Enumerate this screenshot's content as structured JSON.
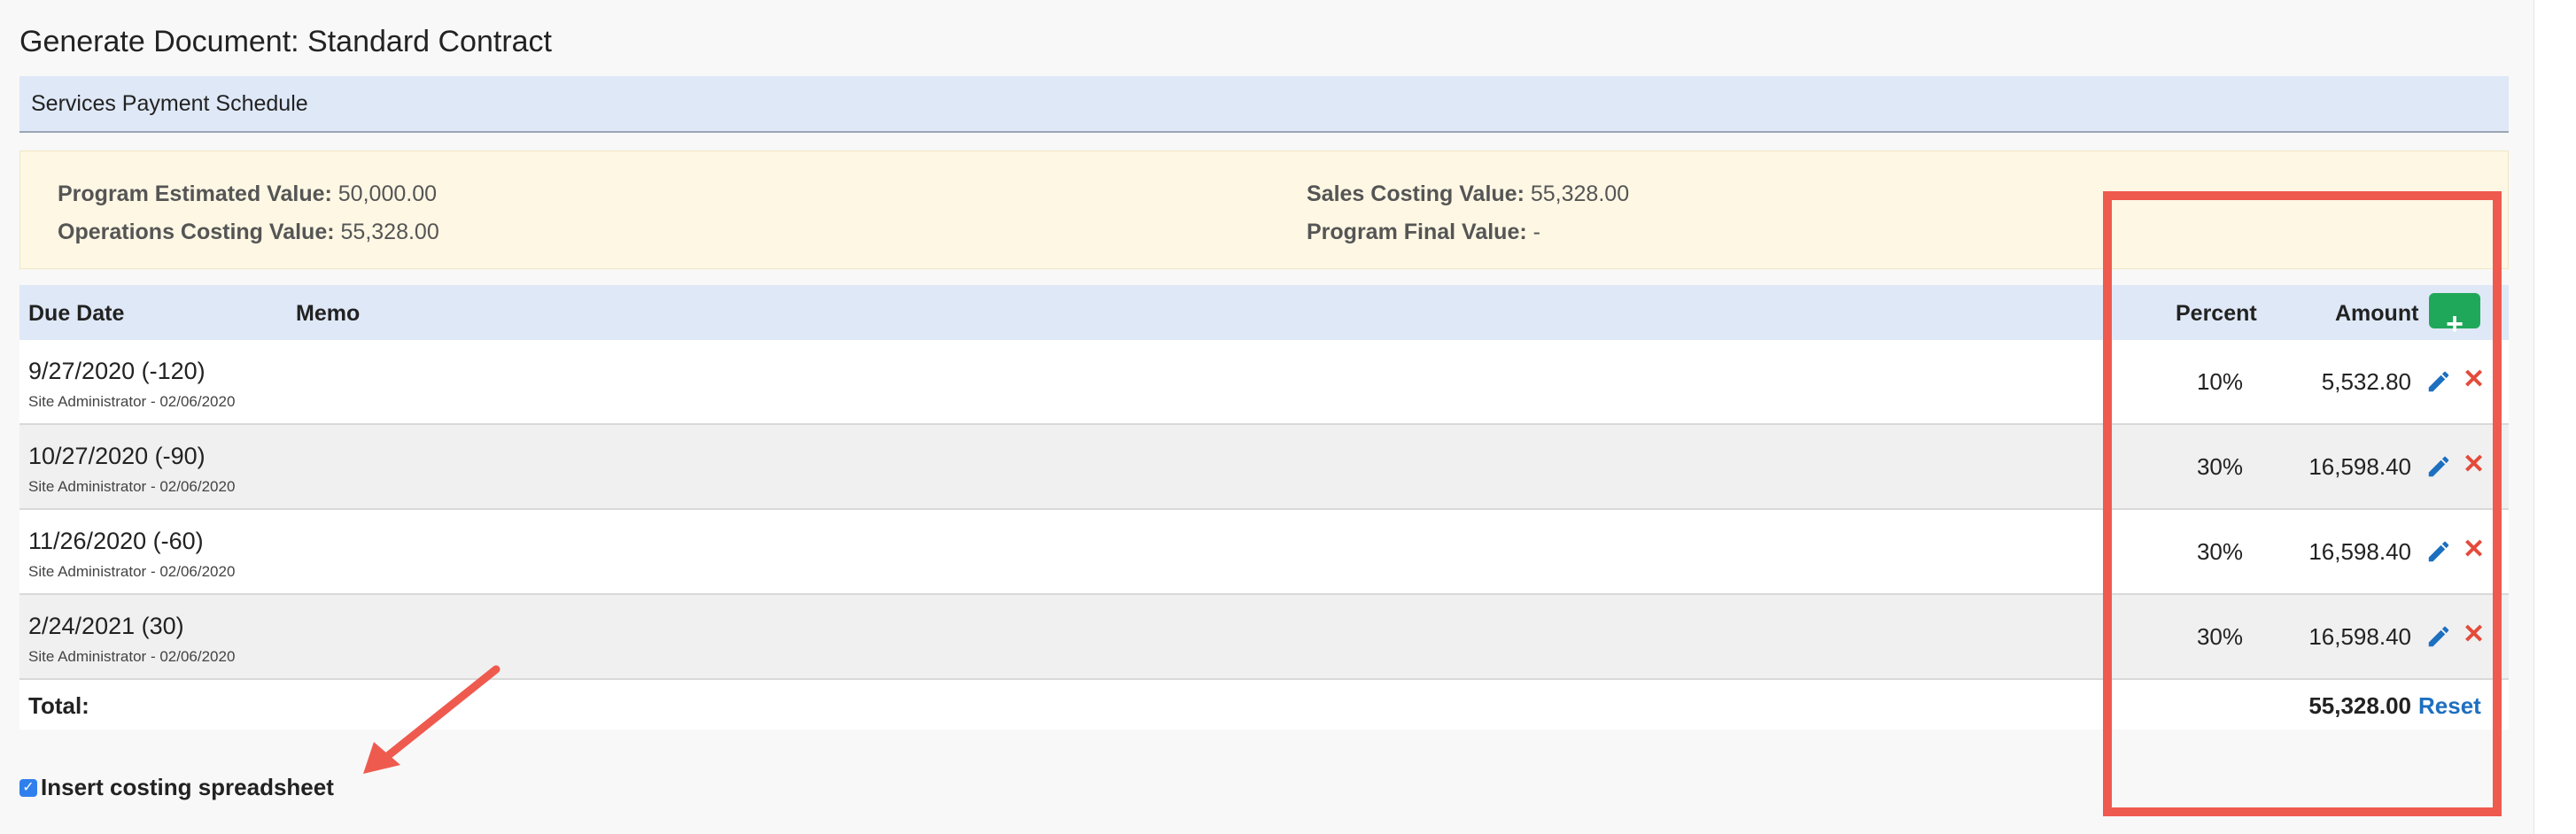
{
  "page": {
    "title": "Generate Document: Standard Contract"
  },
  "section": {
    "title": "Services Payment Schedule"
  },
  "summary": {
    "program_estimated_label": "Program Estimated Value:",
    "program_estimated_value": "50,000.00",
    "operations_costing_label": "Operations Costing Value:",
    "operations_costing_value": "55,328.00",
    "sales_costing_label": "Sales Costing Value:",
    "sales_costing_value": "55,328.00",
    "program_final_label": "Program Final Value:",
    "program_final_value": "-"
  },
  "table": {
    "headers": {
      "due_date": "Due Date",
      "memo": "Memo",
      "percent": "Percent",
      "amount": "Amount"
    },
    "add_icon": "plus-icon",
    "rows": [
      {
        "due_date": "9/27/2020 (-120)",
        "meta": "Site Administrator - 02/06/2020",
        "percent": "10%",
        "amount": "5,532.80"
      },
      {
        "due_date": "10/27/2020 (-90)",
        "meta": "Site Administrator - 02/06/2020",
        "percent": "30%",
        "amount": "16,598.40"
      },
      {
        "due_date": "11/26/2020 (-60)",
        "meta": "Site Administrator - 02/06/2020",
        "percent": "30%",
        "amount": "16,598.40"
      },
      {
        "due_date": "2/24/2021 (30)",
        "meta": "Site Administrator - 02/06/2020",
        "percent": "30%",
        "amount": "16,598.40"
      }
    ],
    "total_label": "Total:",
    "total_value": "55,328.00",
    "reset_label": "Reset"
  },
  "options": {
    "insert_costing_label": "Insert costing spreadsheet",
    "insert_costing_checked": true
  },
  "colors": {
    "accent": "#1d6fc0",
    "add": "#1fa859",
    "delete": "#e34b3b",
    "highlight": "#ef5a4f",
    "header_bg": "#dfe8f7",
    "info_bg": "#fdf7e4"
  }
}
